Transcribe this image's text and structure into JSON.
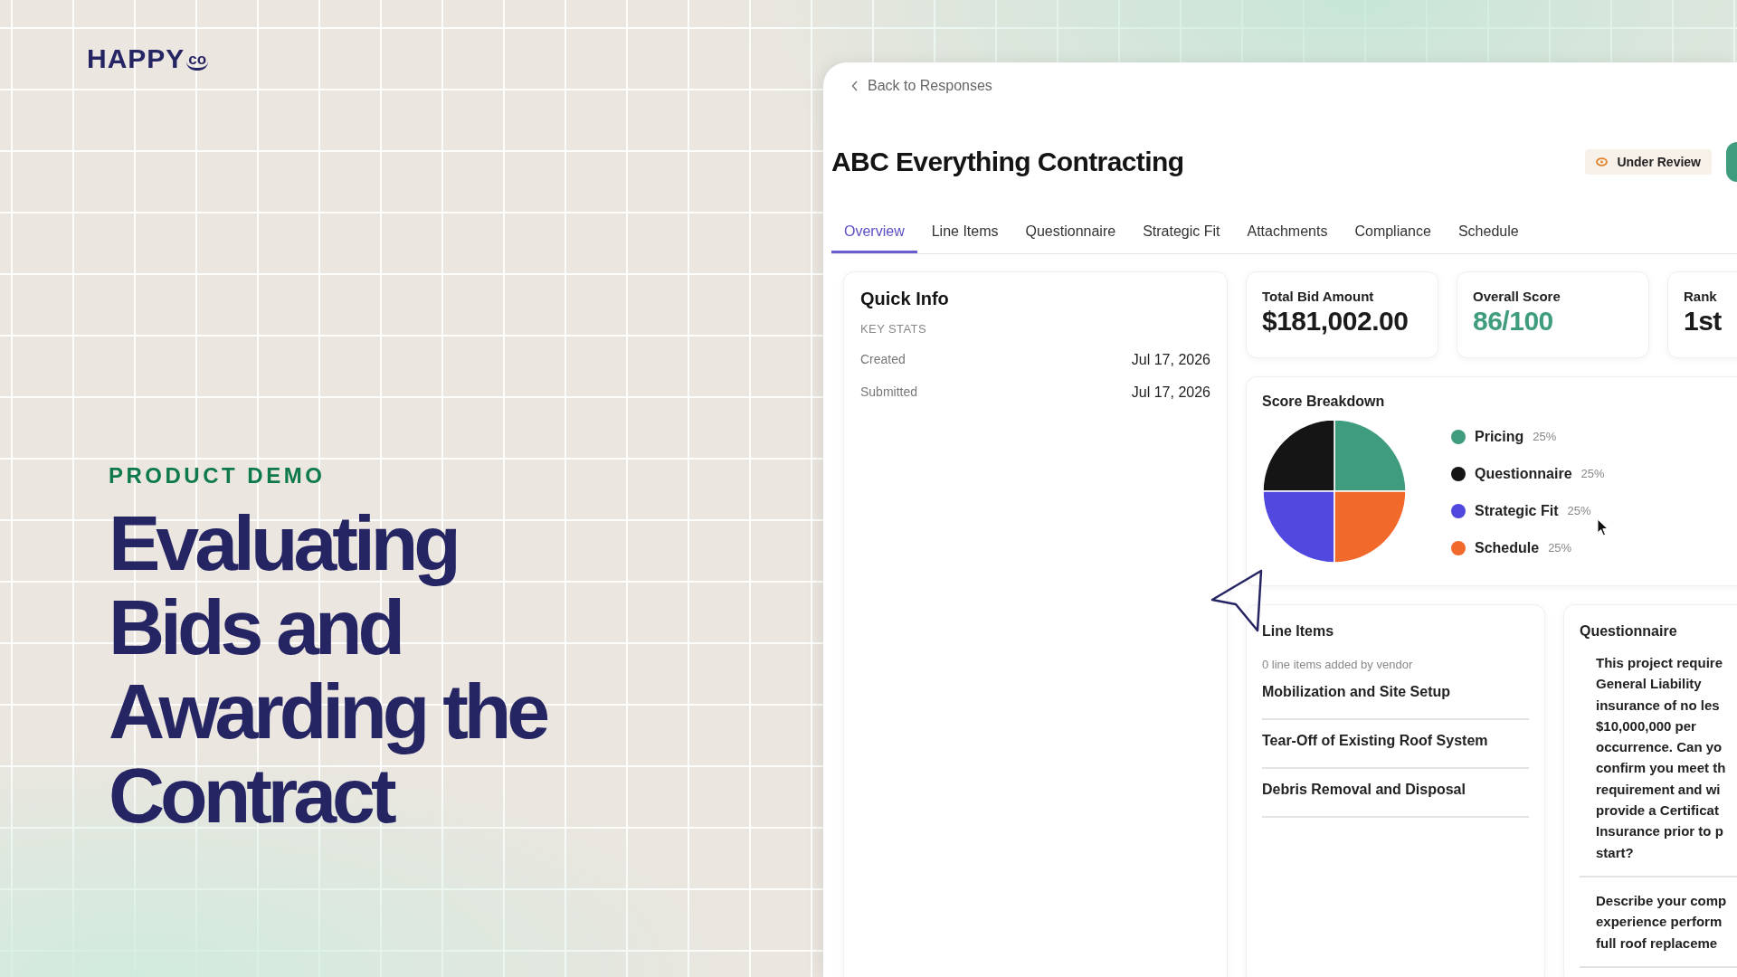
{
  "logo": {
    "text": "HAPPY",
    "mark": "co"
  },
  "eyebrow": "PRODUCT DEMO",
  "title_lines": [
    "Evaluating",
    "Bids and",
    "Awarding the",
    "Contract"
  ],
  "app": {
    "back_link": "Back to Responses",
    "title": "ABC Everything Contracting",
    "status": "Under Review",
    "tabs": [
      {
        "label": "Overview",
        "selected": true
      },
      {
        "label": "Line Items",
        "selected": false
      },
      {
        "label": "Questionnaire",
        "selected": false
      },
      {
        "label": "Strategic Fit",
        "selected": false
      },
      {
        "label": "Attachments",
        "selected": false
      },
      {
        "label": "Compliance",
        "selected": false
      },
      {
        "label": "Schedule",
        "selected": false
      }
    ],
    "quick_info": {
      "title": "Quick Info",
      "section": "KEY STATS",
      "rows": [
        {
          "label": "Created",
          "value": "Jul 17, 2026"
        },
        {
          "label": "Submitted",
          "value": "Jul 17, 2026"
        }
      ]
    },
    "stats": [
      {
        "label": "Total Bid Amount",
        "value": "$181,002.00",
        "kind": "plain"
      },
      {
        "label": "Overall Score",
        "value": "86/100",
        "kind": "score"
      },
      {
        "label": "Rank",
        "value": "1st",
        "kind": "plain"
      }
    ],
    "score_breakdown": {
      "title": "Score Breakdown",
      "chart_data": {
        "type": "pie",
        "values": [
          25,
          25,
          25,
          25
        ]
      },
      "legend": [
        {
          "label": "Pricing",
          "percent": "25%",
          "color": "#3f9c7f"
        },
        {
          "label": "Questionnaire",
          "percent": "25%",
          "color": "#151515"
        },
        {
          "label": "Strategic Fit",
          "percent": "25%",
          "color": "#5148e0"
        },
        {
          "label": "Schedule",
          "percent": "25%",
          "color": "#f26a2b"
        }
      ]
    },
    "line_items": {
      "title": "Line Items",
      "note": "0 line items added by vendor",
      "items": [
        "Mobilization and Site Setup",
        "Tear-Off of Existing Roof System",
        "Debris Removal and Disposal"
      ]
    },
    "questionnaire": {
      "title": "Questionnaire",
      "questions": [
        [
          "This project require",
          "General Liability",
          "insurance of no les",
          "$10,000,000 per",
          "occurrence. Can yo",
          "confirm you meet th",
          "requirement and wi",
          "provide a Certificat",
          "Insurance prior to p",
          "start?"
        ],
        [
          "Describe your comp",
          "experience perform",
          "full roof replaceme"
        ]
      ]
    }
  }
}
